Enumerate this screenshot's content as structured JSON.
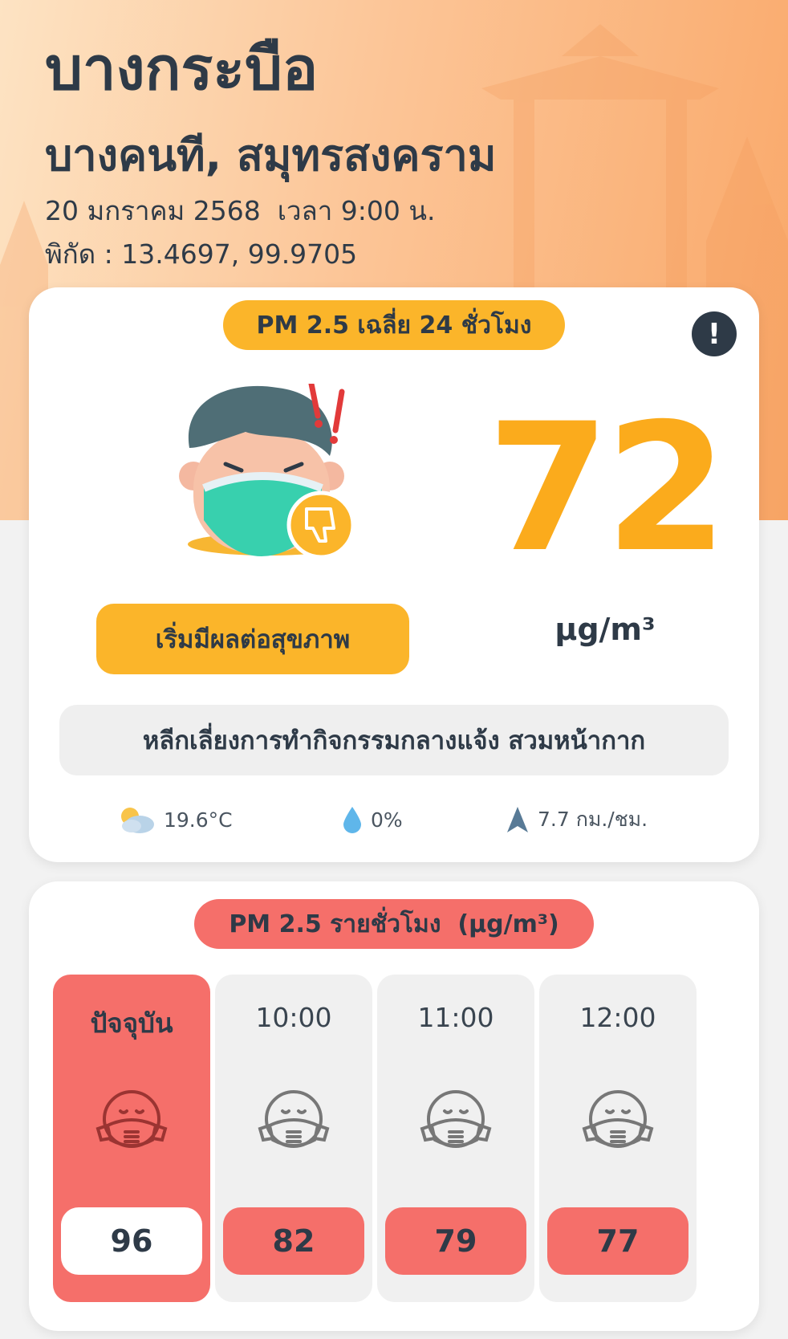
{
  "location": {
    "name": "บางกระบือ",
    "district_province": "บางคนที, สมุทรสงคราม",
    "datetime": "20 มกราคม 2568  เวลา 9:00 น.",
    "coordinates": "พิกัด : 13.4697, 99.9705"
  },
  "main_card": {
    "title": "PM 2.5 เฉลี่ย 24 ชั่วโมง",
    "info_icon": "exclamation-icon",
    "value": "72",
    "unit": "µg/m³",
    "level_label": "เริ่มมีผลต่อสุขภาพ",
    "level_color": "#fbb52a",
    "value_color": "#fbab1c",
    "advice": "หลีกเลี่ยงการทำกิจกรรมกลางแจ้ง สวมหน้ากาก",
    "weather": {
      "temperature": "19.6°C",
      "temperature_icon": "partly-cloudy-icon",
      "rain": "0%",
      "rain_icon": "water-drop-icon",
      "wind": "7.7 กม./ชม.",
      "wind_icon": "wind-direction-arrow-icon"
    }
  },
  "hourly_card": {
    "title": "PM 2.5 รายชั่วโมง  (µg/m³)",
    "title_color": "#f56f6a",
    "hours": [
      {
        "label": "ปัจจุบัน",
        "value": "96",
        "icon": "masked-face-icon"
      },
      {
        "label": "10:00",
        "value": "82",
        "icon": "masked-face-icon"
      },
      {
        "label": "11:00",
        "value": "79",
        "icon": "masked-face-icon"
      },
      {
        "label": "12:00",
        "value": "77",
        "icon": "masked-face-icon"
      }
    ]
  }
}
